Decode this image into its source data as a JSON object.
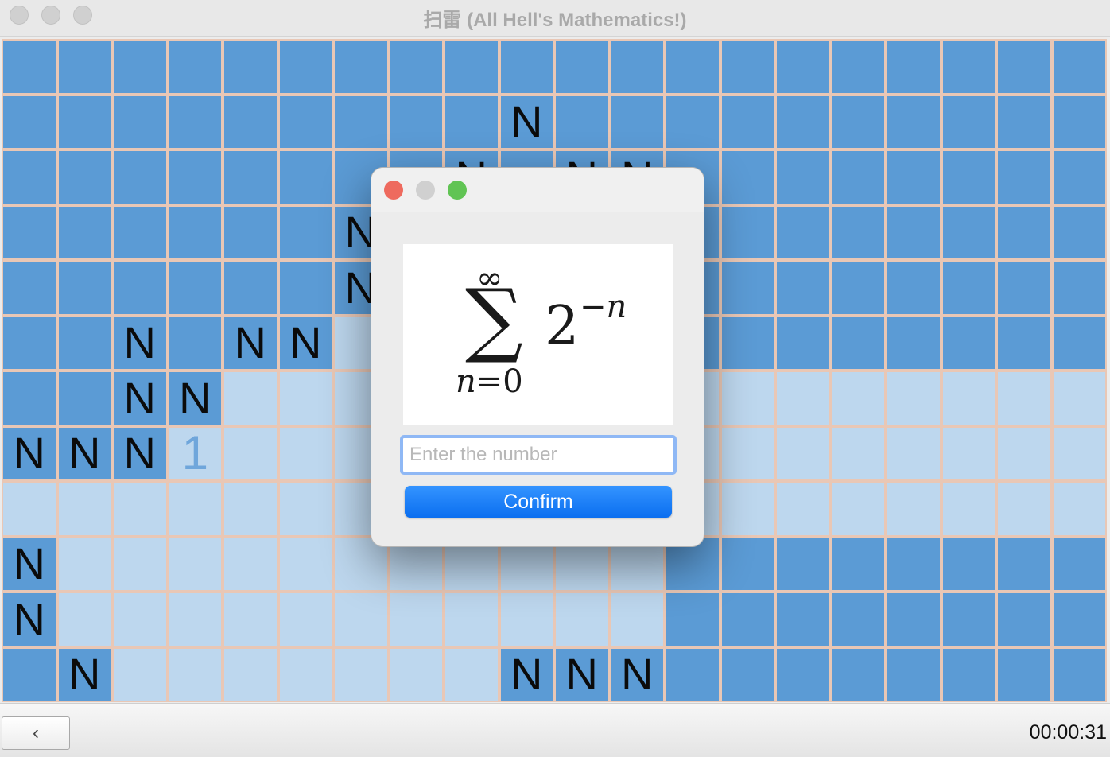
{
  "window": {
    "title": "扫雷 (All Hell's Mathematics!)"
  },
  "board": {
    "columns": 20,
    "rows": 12,
    "legend": {
      "#": "covered",
      ".": "revealed empty",
      "N": "covered with N mark",
      "1": "revealed number 1"
    },
    "grid": [
      "####################",
      "#########N##########",
      "########N#NN########",
      "######N#############",
      "######N#############",
      "##N#NN.#############",
      "##NN................",
      "NNN1................",
      "....................",
      "N...........########",
      "N...........########",
      "#N.......NNN########"
    ]
  },
  "dialog": {
    "formula": {
      "upper": "∞",
      "operator": "∑",
      "lower_var": "n",
      "lower_eq": "=0",
      "base": "2",
      "exponent": "−n"
    },
    "input": {
      "placeholder": "Enter the number",
      "value": ""
    },
    "confirm_label": "Confirm",
    "colors": {
      "close": "#ee6a5e",
      "minimize": "#d0d0d0",
      "zoom": "#61c454",
      "accent": "#0a6ef0"
    }
  },
  "footer": {
    "back_label": "‹",
    "timer": "00:00:31"
  }
}
